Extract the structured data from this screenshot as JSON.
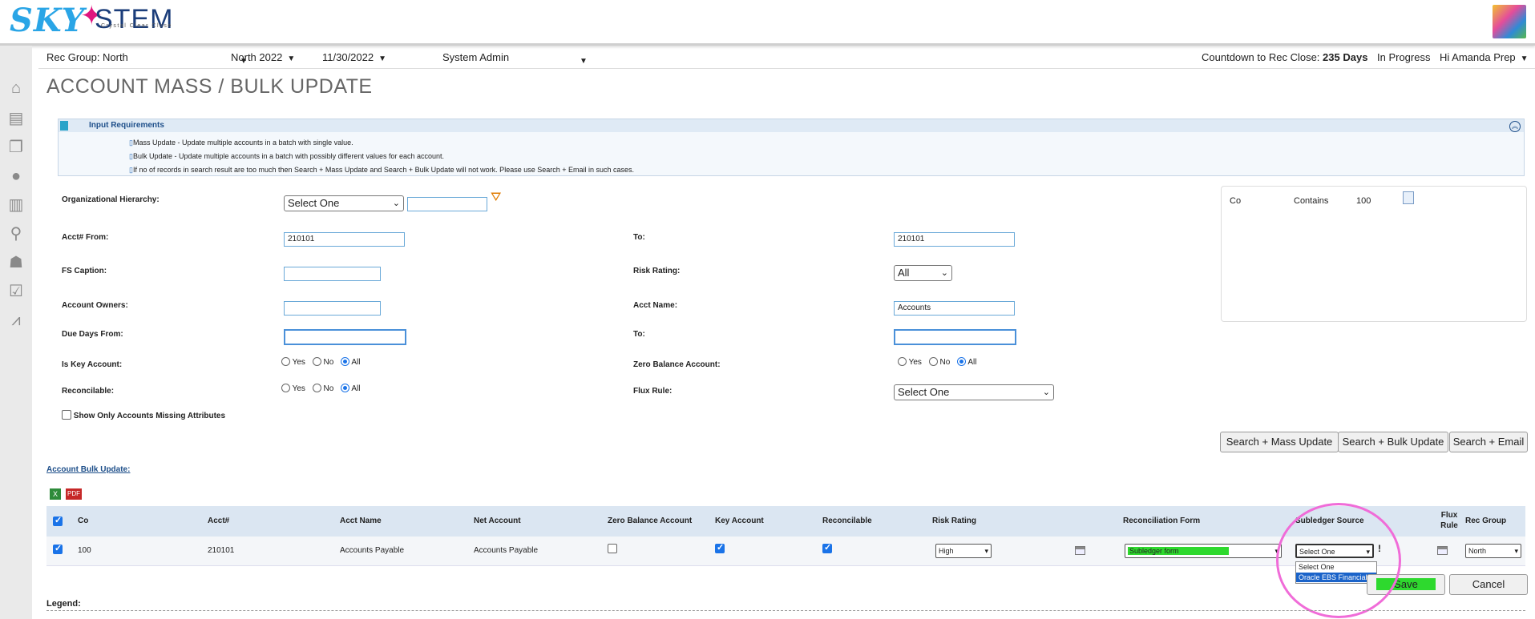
{
  "brand": {
    "logo_sky": "SKY",
    "logo_stem": "STEM",
    "tagline": "Crystal Clear Close"
  },
  "header": {
    "rec_group_label": "Rec Group:",
    "rec_group_value": "North",
    "period": "North 2022",
    "date": "11/30/2022",
    "role": "System Admin",
    "countdown_label": "Countdown to Rec Close:",
    "countdown_value": "235 Days",
    "status": "In Progress",
    "greeting": "Hi Amanda Prep"
  },
  "page": {
    "title": "ACCOUNT MASS / BULK UPDATE"
  },
  "requirements": {
    "title": "Input Requirements",
    "lines": [
      "Mass Update - Update multiple accounts in a batch with single value.",
      "Bulk Update - Update multiple accounts in a batch with possibly different values for each account.",
      "If no of records in search result are too much then Search + Mass Update and Search + Bulk Update will not work. Please use Search + Email in such cases."
    ]
  },
  "form": {
    "org_hierarchy_label": "Organizational Hierarchy:",
    "org_hierarchy_value": "Select One",
    "acct_from_label": "Acct# From:",
    "acct_from_value": "210101",
    "acct_to_label": "To:",
    "acct_to_value": "210101",
    "fs_caption_label": "FS Caption:",
    "risk_rating_label": "Risk Rating:",
    "risk_rating_value": "All",
    "account_owners_label": "Account Owners:",
    "acct_name_label": "Acct Name:",
    "acct_name_value": "Accounts",
    "due_days_label": "Due Days From:",
    "due_days_to_label": "To:",
    "is_key_label": "Is Key Account:",
    "zero_balance_label": "Zero Balance Account:",
    "reconcilable_label": "Reconcilable:",
    "flux_rule_label": "Flux Rule:",
    "flux_rule_value": "Select One",
    "radio_yes": "Yes",
    "radio_no": "No",
    "radio_all": "All",
    "missing_attr_label": "Show Only Accounts Missing Attributes"
  },
  "filter_summary": {
    "field": "Co",
    "operator": "Contains",
    "value": "100"
  },
  "buttons": {
    "search_mass": "Search + Mass Update",
    "search_bulk": "Search + Bulk Update",
    "search_email": "Search + Email",
    "save": "Save",
    "cancel": "Cancel"
  },
  "bulk_update": {
    "link": "Account Bulk Update:",
    "columns": [
      "Co",
      "Acct#",
      "Acct Name",
      "Net Account",
      "Zero Balance Account",
      "Key Account",
      "Reconcilable",
      "Risk Rating",
      "Reconciliation Form",
      "Subledger Source",
      "Flux Rule",
      "Rec Group"
    ],
    "row": {
      "co": "100",
      "acct": "210101",
      "acct_name": "Accounts Payable",
      "net_account": "Accounts Payable",
      "risk_rating": "High",
      "rec_form": "Subledger form",
      "subledger_source": "Select One",
      "rec_group": "North"
    },
    "subledger_options": [
      "Select One",
      "Oracle EBS Financials"
    ],
    "highlighted_option": "Oracle EBS Financials"
  },
  "legend": {
    "label": "Legend:"
  },
  "colors": {
    "accent": "#1a73e8",
    "annotation": "#f06cd8",
    "highlight": "#2ed92e"
  }
}
